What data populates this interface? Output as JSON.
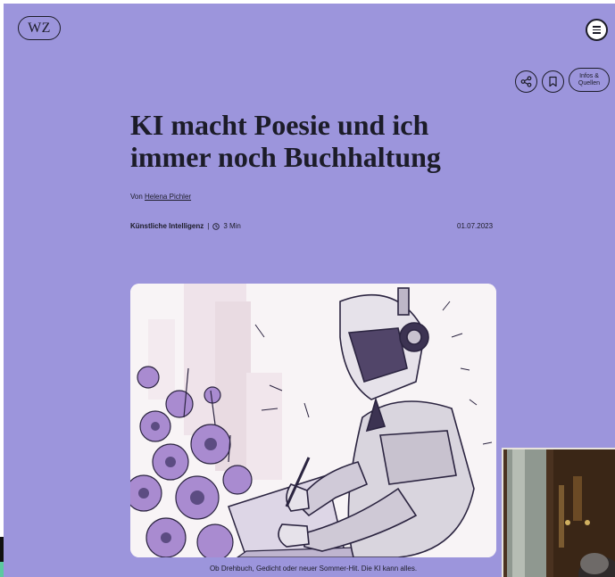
{
  "header": {
    "logo_text": "WZ",
    "menu_icon": "hamburger-icon"
  },
  "actions": {
    "share_icon": "share-icon",
    "bookmark_icon": "bookmark-icon",
    "info_label": "Infos &\nQuellen"
  },
  "article": {
    "title": "KI macht Poesie und ich immer noch Buchhaltung",
    "by_prefix": "Von",
    "author": "Helena Pichler",
    "category": "Künstliche Intelligenz",
    "separator": "|",
    "read_time": "3 Min",
    "date": "01.07.2023",
    "image_alt": "Illustration: Roboter schreibt neben Blumen an einem Laptop",
    "caption": "Ob Drehbuch, Gedicht oder neuer Sommer-Hit. Die KI kann alles."
  },
  "colors": {
    "background": "#9c95dc",
    "text": "#1c1c28",
    "flowers": "#a98bd0"
  }
}
